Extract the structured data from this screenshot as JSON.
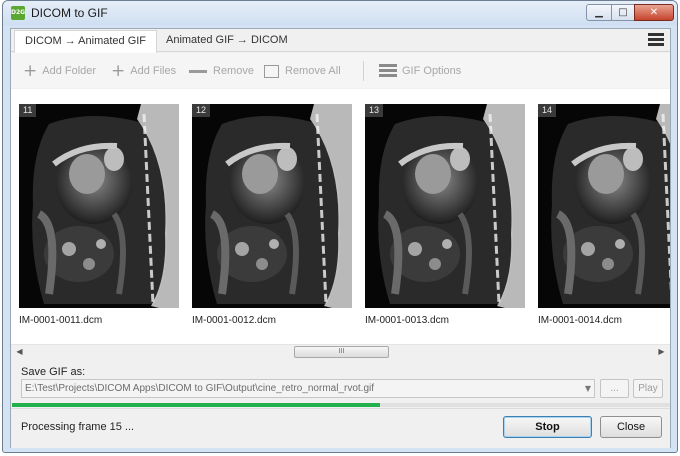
{
  "window": {
    "title": "DICOM to GIF",
    "icon_text": "D2G",
    "controls": {
      "minimize": "▁",
      "maximize": "□",
      "close": "✕"
    }
  },
  "tabs": [
    {
      "label": "DICOM → Animated GIF",
      "active": true
    },
    {
      "label": "Animated GIF → DICOM",
      "active": false
    }
  ],
  "toolbar": {
    "add_folder": "Add Folder",
    "add_files": "Add Files",
    "remove": "Remove",
    "remove_all": "Remove All",
    "gif_options": "GIF Options",
    "add_glyph": "+"
  },
  "thumbnails": [
    {
      "frame": "11",
      "filename": "IM-0001-0011.dcm"
    },
    {
      "frame": "12",
      "filename": "IM-0001-0012.dcm"
    },
    {
      "frame": "13",
      "filename": "IM-0001-0013.dcm"
    },
    {
      "frame": "14",
      "filename": "IM-0001-0014.dcm"
    }
  ],
  "scrollbar": {
    "left_arrow": "◀",
    "right_arrow": "▶",
    "grip": "III"
  },
  "save": {
    "label": "Save GIF as:",
    "path": "E:\\Test\\Projects\\DICOM Apps\\DICOM to GIF\\Output\\cine_retro_normal_rvot.gif",
    "dropdown_arrow": "▼",
    "browse_label": "...",
    "play_label": "Play"
  },
  "progress": {
    "fraction": 0.56,
    "color": "#21b04b"
  },
  "status": {
    "text": "Processing frame 15 ..."
  },
  "buttons": {
    "stop": "Stop",
    "close": "Close"
  }
}
